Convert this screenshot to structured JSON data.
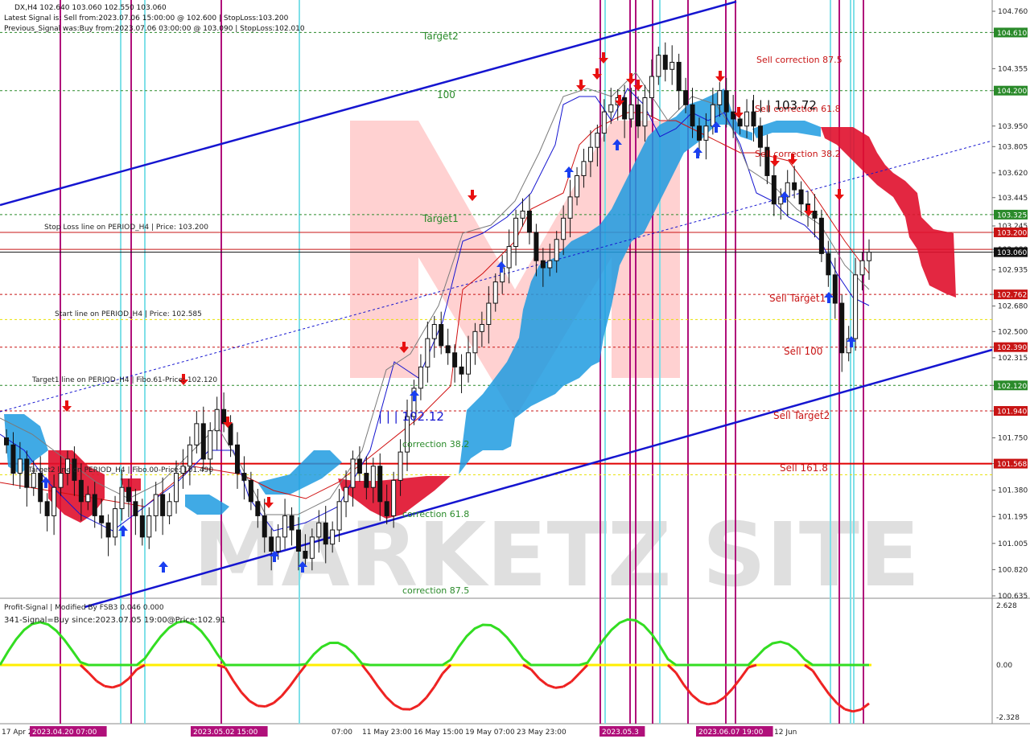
{
  "header": {
    "symbol_line": "DX,H4  102.640 103.060 102.550 103.060",
    "latest_signal": "Latest Signal is: Sell from:2023.07.06 15:00:00 @ 102.600 | StopLoss:103.200",
    "previous_signal": "Previous_Signal was:Buy from:2023.07.06 03:00:00 @ 103.090 | StopLoss:102.010"
  },
  "price_axis": {
    "ticks": [
      "104.760",
      "104.610",
      "104.355",
      "104.200",
      "103.950",
      "103.805",
      "103.620",
      "103.445",
      "103.325",
      "103.245",
      "103.200",
      "103.080",
      "103.060",
      "102.935",
      "102.762",
      "102.680",
      "102.500",
      "102.390",
      "102.315",
      "102.120",
      "101.940",
      "101.750",
      "101.568",
      "101.380",
      "101.195",
      "101.005",
      "100.820",
      "100.635"
    ],
    "tag_values": [
      "104.610",
      "104.200",
      "103.325",
      "103.200",
      "103.060",
      "102.762",
      "102.390",
      "102.120",
      "101.940",
      "101.568"
    ]
  },
  "level_labels": {
    "target2": "Target2",
    "level100": "100",
    "target1": "Target1",
    "stop_loss_line": "Stop Loss line on PERIOD_H4 | Price: 103.200",
    "start_line": "Start line on PERIOD_H4 | Price: 102.585",
    "target1_line": "Target1 line on PERIOD_H4 | Fibo.61-Price: 102.120",
    "target2_line": "Target2 line on PERIOD_H4 | Fibo.00-Price: 101.490",
    "sell_corr_875": "Sell correction 87.5",
    "sell_corr_618": "Sell correction 61.8",
    "sell_corr_382": "Sell correction 38.2",
    "sell_target1": "Sell Target1",
    "sell_100": "Sell 100",
    "sell_target2": "Sell Target2",
    "sell_1618": "Sell 161.8",
    "corr_382": "correction 38.2",
    "corr_618": "correction 61.8",
    "corr_875": "correction 87.5",
    "price_10372": "| | | 103.72",
    "price_10212": "| | | 102.12"
  },
  "indicator": {
    "title": "Profit-Signal | Modified By FSB3 0.046 0.000",
    "signal": "341-Signal=Buy since:2023.07.05 19:00@Price:102.91",
    "scale_top": "2.628",
    "scale_mid": "0.00",
    "scale_bottom": "-2.328"
  },
  "time_axis": {
    "labels": [
      "17 Apr 2023",
      "4",
      "07:00",
      "11 May 23:00",
      "16 May 15:00",
      "19 May 07:00",
      "23 May 23:00",
      "12 Jun"
    ],
    "highlighted": [
      "2023.04.20 07:00",
      "2023.05.02 15:00",
      "2023.05.3",
      "2023.06.07 19:00"
    ]
  },
  "watermark": "MARKETZ SITE",
  "colors": {
    "bull_candle": "#111111",
    "cloud_blue": "#1e9be0",
    "cloud_red": "#e0102c",
    "channel": "#1515d0",
    "magenta_vline": "#b0107a",
    "cyan_vline": "#7fe0e8",
    "level_green": "#2a8a2a",
    "level_red": "#c81414",
    "osc_green": "#33dd22",
    "osc_red": "#ee2222",
    "zero_line": "#ffee00"
  },
  "chart_data": {
    "type": "candlestick",
    "ylim": [
      100.635,
      104.76
    ],
    "close": [
      101.7,
      101.5,
      101.6,
      101.4,
      101.5,
      101.3,
      101.2,
      101.4,
      101.5,
      101.6,
      101.45,
      101.3,
      101.35,
      101.2,
      101.15,
      101.05,
      101.25,
      101.4,
      101.3,
      101.2,
      101.05,
      101.2,
      101.35,
      101.2,
      101.3,
      101.5,
      101.55,
      101.7,
      101.85,
      101.6,
      101.8,
      101.95,
      101.85,
      101.7,
      101.5,
      101.45,
      101.3,
      101.2,
      101.05,
      100.95,
      101.05,
      101.2,
      101.1,
      100.95,
      100.9,
      101.05,
      101.15,
      101.0,
      101.1,
      101.3,
      101.4,
      101.6,
      101.5,
      101.4,
      101.55,
      101.3,
      101.2,
      101.45,
      101.65,
      101.9,
      102.1,
      102.25,
      102.45,
      102.55,
      102.4,
      102.35,
      102.25,
      102.2,
      102.35,
      102.5,
      102.55,
      102.7,
      102.85,
      102.95,
      103.1,
      103.3,
      103.35,
      103.2,
      103.0,
      102.95,
      103.0,
      103.15,
      103.3,
      103.45,
      103.6,
      103.7,
      103.8,
      103.9,
      104.05,
      104.1,
      104.15,
      104.0,
      104.1,
      103.95,
      104.15,
      104.3,
      104.45,
      104.35,
      104.4,
      104.2,
      104.1,
      103.95,
      103.85,
      103.95,
      104.1,
      104.2,
      104.05,
      104.0,
      103.95,
      104.05,
      103.95,
      103.8,
      103.6,
      103.4,
      103.45,
      103.55,
      103.5,
      103.4,
      103.35,
      103.3,
      103.05,
      102.9,
      102.7,
      102.35,
      102.45,
      102.9,
      103.0,
      103.06
    ]
  }
}
